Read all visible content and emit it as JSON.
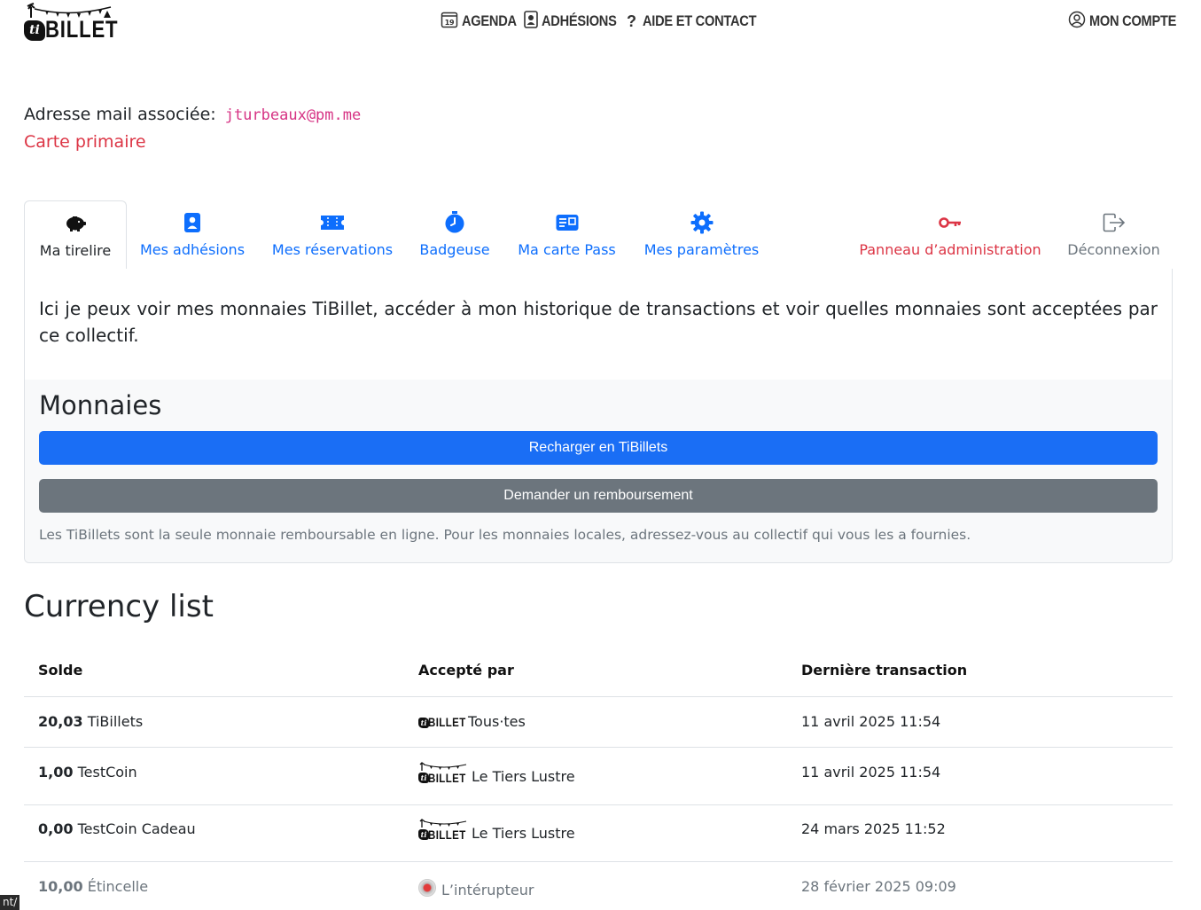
{
  "header": {
    "logo_ti": "ti",
    "logo_word": "BILLET",
    "nav": {
      "agenda": "AGENDA",
      "adhesions": "ADHÉSIONS",
      "aide": "AIDE ET CONTACT",
      "compte": "MON COMPTE"
    },
    "calendar_day": "19"
  },
  "account": {
    "email_label": "Adresse mail associée:",
    "email": "jturbeaux@pm.me",
    "card_status": "Carte primaire"
  },
  "tabs": [
    {
      "label": "Ma tirelire",
      "icon": "piggy-bank-icon",
      "active": true
    },
    {
      "label": "Mes adhésions",
      "icon": "badge-icon"
    },
    {
      "label": "Mes réservations",
      "icon": "ticket-icon"
    },
    {
      "label": "Badgeuse",
      "icon": "stopwatch-icon"
    },
    {
      "label": "Ma carte Pass",
      "icon": "card-icon"
    },
    {
      "label": "Mes paramètres",
      "icon": "gear-icon"
    },
    {
      "label": "Panneau d’administration",
      "icon": "key-icon"
    },
    {
      "label": "Déconnexion",
      "icon": "logout-icon"
    }
  ],
  "wallet": {
    "intro": "Ici je peux voir mes monnaies TiBillet, accéder à mon historique de transactions et voir quelles monnaies sont acceptées par ce collectif.",
    "title": "Monnaies",
    "recharge_button": "Recharger en TiBillets",
    "refund_button": "Demander un remboursement",
    "note": "Les TiBillets sont la seule monnaie remboursable en ligne. Pour les monnaies locales, adressez-vous au collectif qui vous les a fournies."
  },
  "currency_list": {
    "title": "Currency list",
    "headers": {
      "balance": "Solde",
      "accepted_by": "Accepté par",
      "last_tx": "Dernière transaction"
    },
    "rows": [
      {
        "amount": "20,03",
        "currency": "TiBillets",
        "accepted_by": "Tous·tes",
        "logo": "flat",
        "last_tx": "11 avril 2025 11:54"
      },
      {
        "amount": "1,00",
        "currency": "TestCoin",
        "accepted_by": "Le Tiers Lustre",
        "logo": "garland",
        "last_tx": "11 avril 2025 11:54"
      },
      {
        "amount": "0,00",
        "currency": "TestCoin Cadeau",
        "accepted_by": "Le Tiers Lustre",
        "logo": "garland",
        "last_tx": "24 mars 2025 11:52"
      },
      {
        "amount": "10,00",
        "currency": "Étincelle",
        "accepted_by": "L’intérupteur",
        "logo": "red-button",
        "last_tx": "28 février 2025 09:09"
      }
    ]
  },
  "status_bar": "nt/",
  "colors": {
    "primary": "#1a6ef5",
    "secondary": "#6c757d",
    "danger": "#dc3545",
    "email": "#d63384"
  }
}
